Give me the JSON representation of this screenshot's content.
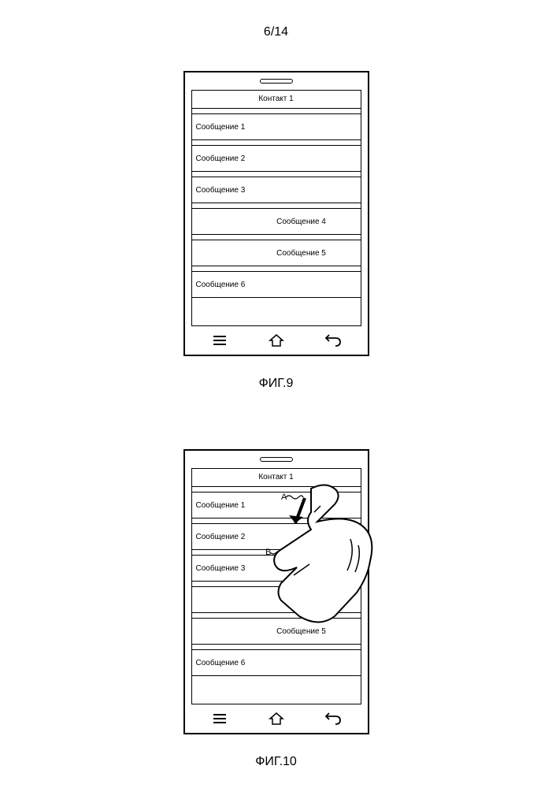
{
  "page_number": "6/14",
  "figures": {
    "fig9": {
      "caption": "ФИГ.9",
      "title": "Контакт 1",
      "rows": [
        {
          "label": "Сообщение 1",
          "align": "left"
        },
        {
          "label": "Сообщение 2",
          "align": "left"
        },
        {
          "label": "Сообщение 3",
          "align": "left"
        },
        {
          "label": "Сообщение 4",
          "align": "right"
        },
        {
          "label": "Сообщение 5",
          "align": "right"
        },
        {
          "label": "Сообщение 6",
          "align": "left"
        }
      ],
      "nav": {
        "menu": "menu-icon",
        "home": "home-icon",
        "back": "back-icon"
      }
    },
    "fig10": {
      "caption": "ФИГ.10",
      "title": "Контакт 1",
      "rows": [
        {
          "label": "Сообщение 1",
          "align": "left"
        },
        {
          "label": "Сообщение 2",
          "align": "left"
        },
        {
          "label": "Сообщение 3",
          "align": "left"
        },
        {
          "label": "",
          "align": "left"
        },
        {
          "label": "Сообщение 5",
          "align": "right"
        },
        {
          "label": "Сообщение 6",
          "align": "left"
        }
      ],
      "gesture": {
        "label_a": "A",
        "label_b": "B",
        "description": "pinch-gesture"
      },
      "nav": {
        "menu": "menu-icon",
        "home": "home-icon",
        "back": "back-icon"
      }
    }
  }
}
